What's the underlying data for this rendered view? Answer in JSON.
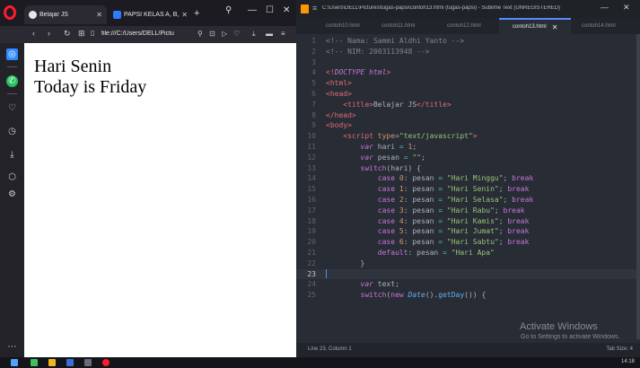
{
  "browser": {
    "tabs": [
      {
        "label": "Belajar JS",
        "active": true
      },
      {
        "label": "PAPSI KELAS A, B, C",
        "active": false
      }
    ],
    "url": "file:///C:/Users/DELL/Pictu",
    "page_lines": [
      "Hari Senin",
      "Today is Friday"
    ]
  },
  "editor": {
    "window_title": "C:\\Users\\DELL\\Pictures\\tugas-papsi\\contoh13.html (tugas-papsi) - Sublime Text (UNREGISTERED)",
    "tabs": [
      {
        "label": "contoh10.html",
        "active": false
      },
      {
        "label": "contoh11.html",
        "active": false
      },
      {
        "label": "contoh12.html",
        "active": false
      },
      {
        "label": "contoh13.html",
        "active": true
      },
      {
        "label": "contoh14.html",
        "active": false
      }
    ],
    "status_left": "Line 23, Column 1",
    "status_right": "Tab Size: 4",
    "watermark_title": "Activate Windows",
    "watermark_sub": "Go to Settings to activate Windows.",
    "current_line": 23,
    "lines": [
      {
        "n": 1,
        "tokens": [
          [
            "cmt",
            "<!-- Nama: Sammi Aldhi Yanto -->"
          ]
        ]
      },
      {
        "n": 2,
        "tokens": [
          [
            "cmt",
            "<!-- NIM: 2003113948 -->"
          ]
        ]
      },
      {
        "n": 3,
        "tokens": []
      },
      {
        "n": 4,
        "tokens": [
          [
            "tag",
            "<!"
          ],
          [
            "doct",
            "DOCTYPE html"
          ],
          [
            "tag",
            ">"
          ]
        ]
      },
      {
        "n": 5,
        "tokens": [
          [
            "tag",
            "<html>"
          ]
        ]
      },
      {
        "n": 6,
        "tokens": [
          [
            "tag",
            "<head>"
          ]
        ]
      },
      {
        "n": 7,
        "tokens": [
          [
            "",
            "    "
          ],
          [
            "tag",
            "<title>"
          ],
          [
            "",
            "Belajar JS"
          ],
          [
            "tag",
            "</title>"
          ]
        ]
      },
      {
        "n": 8,
        "tokens": [
          [
            "tag",
            "</head>"
          ]
        ]
      },
      {
        "n": 9,
        "tokens": [
          [
            "tag",
            "<body>"
          ]
        ]
      },
      {
        "n": 10,
        "tokens": [
          [
            "",
            "    "
          ],
          [
            "tag",
            "<script "
          ],
          [
            "attr",
            "type"
          ],
          [
            "",
            "="
          ],
          [
            "str",
            "\"text/javascript\""
          ],
          [
            "tag",
            ">"
          ]
        ]
      },
      {
        "n": 11,
        "tokens": [
          [
            "",
            "        "
          ],
          [
            "kw",
            "var"
          ],
          [
            "",
            " hari "
          ],
          [
            "op",
            "="
          ],
          [
            "",
            " "
          ],
          [
            "num",
            "1"
          ],
          [
            "",
            ";"
          ]
        ]
      },
      {
        "n": 12,
        "tokens": [
          [
            "",
            "        "
          ],
          [
            "kw",
            "var"
          ],
          [
            "",
            " pesan "
          ],
          [
            "op",
            "="
          ],
          [
            "",
            " "
          ],
          [
            "str",
            "\"\""
          ],
          [
            "",
            ";"
          ]
        ]
      },
      {
        "n": 13,
        "tokens": [
          [
            "",
            "        "
          ],
          [
            "kw2",
            "switch"
          ],
          [
            "",
            "(hari) {"
          ]
        ]
      },
      {
        "n": 14,
        "tokens": [
          [
            "",
            "            "
          ],
          [
            "kw2",
            "case"
          ],
          [
            "",
            " "
          ],
          [
            "num",
            "0"
          ],
          [
            "",
            ": pesan "
          ],
          [
            "op",
            "="
          ],
          [
            "",
            " "
          ],
          [
            "str",
            "\"Hari Minggu\""
          ],
          [
            "",
            "; "
          ],
          [
            "kw2",
            "break"
          ]
        ]
      },
      {
        "n": 15,
        "tokens": [
          [
            "",
            "            "
          ],
          [
            "kw2",
            "case"
          ],
          [
            "",
            " "
          ],
          [
            "num",
            "1"
          ],
          [
            "",
            ": pesan "
          ],
          [
            "op",
            "="
          ],
          [
            "",
            " "
          ],
          [
            "str",
            "\"Hari Senin\""
          ],
          [
            "",
            "; "
          ],
          [
            "kw2",
            "break"
          ]
        ]
      },
      {
        "n": 16,
        "tokens": [
          [
            "",
            "            "
          ],
          [
            "kw2",
            "case"
          ],
          [
            "",
            " "
          ],
          [
            "num",
            "2"
          ],
          [
            "",
            ": pesan "
          ],
          [
            "op",
            "="
          ],
          [
            "",
            " "
          ],
          [
            "str",
            "\"Hari Selasa\""
          ],
          [
            "",
            "; "
          ],
          [
            "kw2",
            "break"
          ]
        ]
      },
      {
        "n": 17,
        "tokens": [
          [
            "",
            "            "
          ],
          [
            "kw2",
            "case"
          ],
          [
            "",
            " "
          ],
          [
            "num",
            "3"
          ],
          [
            "",
            ": pesan "
          ],
          [
            "op",
            "="
          ],
          [
            "",
            " "
          ],
          [
            "str",
            "\"Hari Rabu\""
          ],
          [
            "",
            "; "
          ],
          [
            "kw2",
            "break"
          ]
        ]
      },
      {
        "n": 18,
        "tokens": [
          [
            "",
            "            "
          ],
          [
            "kw2",
            "case"
          ],
          [
            "",
            " "
          ],
          [
            "num",
            "4"
          ],
          [
            "",
            ": pesan "
          ],
          [
            "op",
            "="
          ],
          [
            "",
            " "
          ],
          [
            "str",
            "\"Hari Kamis\""
          ],
          [
            "",
            "; "
          ],
          [
            "kw2",
            "break"
          ]
        ]
      },
      {
        "n": 19,
        "tokens": [
          [
            "",
            "            "
          ],
          [
            "kw2",
            "case"
          ],
          [
            "",
            " "
          ],
          [
            "num",
            "5"
          ],
          [
            "",
            ": pesan "
          ],
          [
            "op",
            "="
          ],
          [
            "",
            " "
          ],
          [
            "str",
            "\"Hari Jumat\""
          ],
          [
            "",
            "; "
          ],
          [
            "kw2",
            "break"
          ]
        ]
      },
      {
        "n": 20,
        "tokens": [
          [
            "",
            "            "
          ],
          [
            "kw2",
            "case"
          ],
          [
            "",
            " "
          ],
          [
            "num",
            "6"
          ],
          [
            "",
            ": pesan "
          ],
          [
            "op",
            "="
          ],
          [
            "",
            " "
          ],
          [
            "str",
            "\"Hari Sabtu\""
          ],
          [
            "",
            "; "
          ],
          [
            "kw2",
            "break"
          ]
        ]
      },
      {
        "n": 21,
        "tokens": [
          [
            "",
            "            "
          ],
          [
            "kw2",
            "default"
          ],
          [
            "",
            ": pesan "
          ],
          [
            "op",
            "="
          ],
          [
            "",
            " "
          ],
          [
            "str",
            "\"Hari Apa\""
          ]
        ]
      },
      {
        "n": 22,
        "tokens": [
          [
            "",
            "        }"
          ]
        ]
      },
      {
        "n": 23,
        "tokens": []
      },
      {
        "n": 24,
        "tokens": [
          [
            "",
            "        "
          ],
          [
            "kw",
            "var"
          ],
          [
            "",
            " text;"
          ]
        ]
      },
      {
        "n": 25,
        "tokens": [
          [
            "",
            "        "
          ],
          [
            "kw2",
            "switch"
          ],
          [
            "",
            "("
          ],
          [
            "kw2",
            "new"
          ],
          [
            "",
            " "
          ],
          [
            "cls",
            "Date"
          ],
          [
            "",
            "()."
          ],
          [
            "fn",
            "getDay"
          ],
          [
            "",
            "()) {"
          ]
        ]
      }
    ]
  },
  "taskbar": {
    "clock": "14:18"
  },
  "colors": {
    "editor_bg": "#282c34",
    "browser_chrome": "#2b2a33",
    "accent_blue": "#528bff",
    "opera_red": "#ff1b2d",
    "sublime_orange": "#ff9800"
  }
}
